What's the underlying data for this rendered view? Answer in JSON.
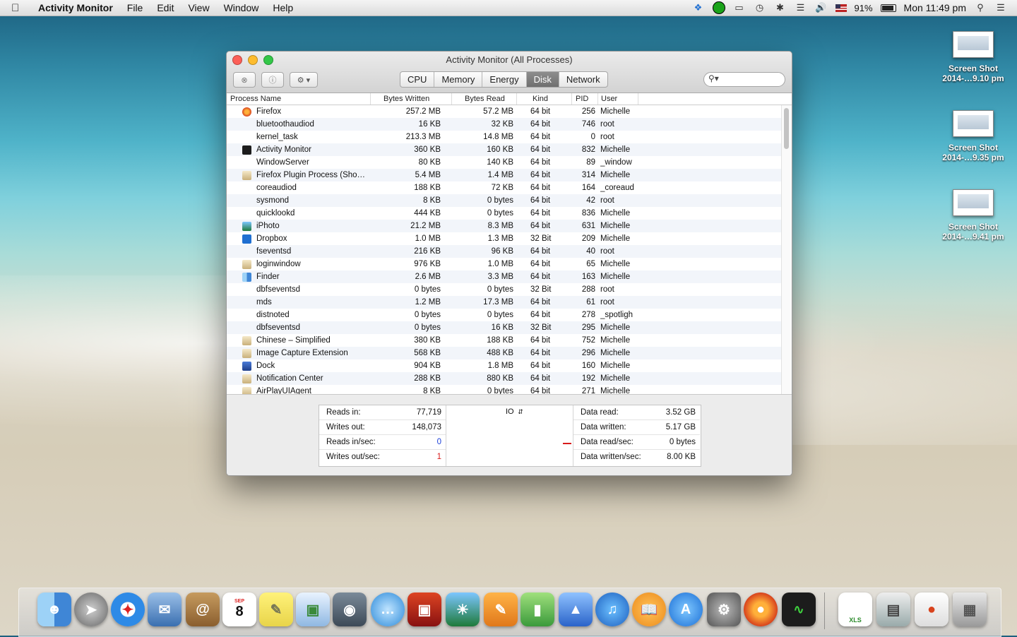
{
  "menubar": {
    "app_name": "Activity Monitor",
    "menus": [
      "File",
      "Edit",
      "View",
      "Window",
      "Help"
    ],
    "battery_percent": "91%",
    "clock": "Mon 11:49 pm"
  },
  "desktop_icons": [
    {
      "line1": "Screen Shot",
      "line2": "2014-…9.10 pm"
    },
    {
      "line1": "Screen Shot",
      "line2": "2014-…9.35 pm"
    },
    {
      "line1": "Screen Shot",
      "line2": "2014-…9.41 pm"
    }
  ],
  "window": {
    "title": "Activity Monitor (All Processes)",
    "tabs": [
      "CPU",
      "Memory",
      "Energy",
      "Disk",
      "Network"
    ],
    "active_tab": "Disk",
    "search_placeholder": ""
  },
  "table": {
    "columns": [
      "Process Name",
      "Bytes Written",
      "Bytes Read",
      "Kind",
      "PID",
      "User"
    ],
    "rows": [
      {
        "name": "Firefox",
        "written": "257.2 MB",
        "read": "57.2 MB",
        "kind": "64 bit",
        "pid": "256",
        "user": "Michelle",
        "icon": "firefox-icon"
      },
      {
        "name": "bluetoothaudiod",
        "written": "16 KB",
        "read": "32 KB",
        "kind": "64 bit",
        "pid": "746",
        "user": "root",
        "icon": ""
      },
      {
        "name": "kernel_task",
        "written": "213.3 MB",
        "read": "14.8 MB",
        "kind": "64 bit",
        "pid": "0",
        "user": "root",
        "icon": ""
      },
      {
        "name": "Activity Monitor",
        "written": "360 KB",
        "read": "160 KB",
        "kind": "64 bit",
        "pid": "832",
        "user": "Michelle",
        "icon": "activity-monitor-icon"
      },
      {
        "name": "WindowServer",
        "written": "80 KB",
        "read": "140 KB",
        "kind": "64 bit",
        "pid": "89",
        "user": "_window",
        "icon": ""
      },
      {
        "name": "Firefox Plugin Process (Sho…",
        "written": "5.4 MB",
        "read": "1.4 MB",
        "kind": "64 bit",
        "pid": "314",
        "user": "Michelle",
        "icon": "app-generic-icon"
      },
      {
        "name": "coreaudiod",
        "written": "188 KB",
        "read": "72 KB",
        "kind": "64 bit",
        "pid": "164",
        "user": "_coreaud",
        "icon": ""
      },
      {
        "name": "sysmond",
        "written": "8 KB",
        "read": "0 bytes",
        "kind": "64 bit",
        "pid": "42",
        "user": "root",
        "icon": ""
      },
      {
        "name": "quicklookd",
        "written": "444 KB",
        "read": "0 bytes",
        "kind": "64 bit",
        "pid": "836",
        "user": "Michelle",
        "icon": ""
      },
      {
        "name": "iPhoto",
        "written": "21.2 MB",
        "read": "8.3 MB",
        "kind": "64 bit",
        "pid": "631",
        "user": "Michelle",
        "icon": "iphoto-icon"
      },
      {
        "name": "Dropbox",
        "written": "1.0 MB",
        "read": "1.3 MB",
        "kind": "32 Bit",
        "pid": "209",
        "user": "Michelle",
        "icon": "dropbox-icon"
      },
      {
        "name": "fseventsd",
        "written": "216 KB",
        "read": "96 KB",
        "kind": "64 bit",
        "pid": "40",
        "user": "root",
        "icon": ""
      },
      {
        "name": "loginwindow",
        "written": "976 KB",
        "read": "1.0 MB",
        "kind": "64 bit",
        "pid": "65",
        "user": "Michelle",
        "icon": "app-generic-icon"
      },
      {
        "name": "Finder",
        "written": "2.6 MB",
        "read": "3.3 MB",
        "kind": "64 bit",
        "pid": "163",
        "user": "Michelle",
        "icon": "finder-icon"
      },
      {
        "name": "dbfseventsd",
        "written": "0 bytes",
        "read": "0 bytes",
        "kind": "32 Bit",
        "pid": "288",
        "user": "root",
        "icon": ""
      },
      {
        "name": "mds",
        "written": "1.2 MB",
        "read": "17.3 MB",
        "kind": "64 bit",
        "pid": "61",
        "user": "root",
        "icon": ""
      },
      {
        "name": "distnoted",
        "written": "0 bytes",
        "read": "0 bytes",
        "kind": "64 bit",
        "pid": "278",
        "user": "_spotligh",
        "icon": ""
      },
      {
        "name": "dbfseventsd",
        "written": "0 bytes",
        "read": "16 KB",
        "kind": "32 Bit",
        "pid": "295",
        "user": "Michelle",
        "icon": ""
      },
      {
        "name": "Chinese – Simplified",
        "written": "380 KB",
        "read": "188 KB",
        "kind": "64 bit",
        "pid": "752",
        "user": "Michelle",
        "icon": "app-generic-icon"
      },
      {
        "name": "Image Capture Extension",
        "written": "568 KB",
        "read": "488 KB",
        "kind": "64 bit",
        "pid": "296",
        "user": "Michelle",
        "icon": "app-generic-icon"
      },
      {
        "name": "Dock",
        "written": "904 KB",
        "read": "1.8 MB",
        "kind": "64 bit",
        "pid": "160",
        "user": "Michelle",
        "icon": "dock-icon"
      },
      {
        "name": "Notification Center",
        "written": "288 KB",
        "read": "880 KB",
        "kind": "64 bit",
        "pid": "192",
        "user": "Michelle",
        "icon": "app-generic-icon"
      },
      {
        "name": "AirPlayUIAgent",
        "written": "8 KB",
        "read": "0 bytes",
        "kind": "64 bit",
        "pid": "271",
        "user": "Michelle",
        "icon": "app-generic-icon"
      }
    ]
  },
  "stats": {
    "reads_in_label": "Reads in:",
    "reads_in": "77,719",
    "writes_out_label": "Writes out:",
    "writes_out": "148,073",
    "reads_sec_label": "Reads in/sec:",
    "reads_sec": "0",
    "writes_sec_label": "Writes out/sec:",
    "writes_sec": "1",
    "graph_selector": "IO",
    "data_read_label": "Data read:",
    "data_read": "3.52 GB",
    "data_written_label": "Data written:",
    "data_written": "5.17 GB",
    "data_read_sec_label": "Data read/sec:",
    "data_read_sec": "0 bytes",
    "data_written_sec_label": "Data written/sec:",
    "data_written_sec": "8.00 KB"
  },
  "colors": {
    "reads_value": "#1a3fd9",
    "writes_value": "#d81b1b",
    "active_tab": "#7a7a7a"
  },
  "dock": {
    "apps": [
      "finder-icon",
      "launchpad-icon",
      "safari-icon",
      "mail-icon",
      "contacts-icon",
      "calendar-icon",
      "notes-icon",
      "preview-icon",
      "facetime-icon",
      "messages-icon",
      "photo-booth-icon",
      "iphoto-icon",
      "pages-icon",
      "numbers-icon",
      "keynote-icon",
      "itunes-icon",
      "ibooks-icon",
      "app-store-icon",
      "system-preferences-icon",
      "firefox-icon",
      "activity-monitor-icon"
    ],
    "calendar_day": "8",
    "calendar_month": "SEP",
    "right_items": [
      "xls-file-icon",
      "documents-stack-icon",
      "downloads-stack-icon",
      "trash-icon"
    ],
    "xls_label": "XLS"
  }
}
